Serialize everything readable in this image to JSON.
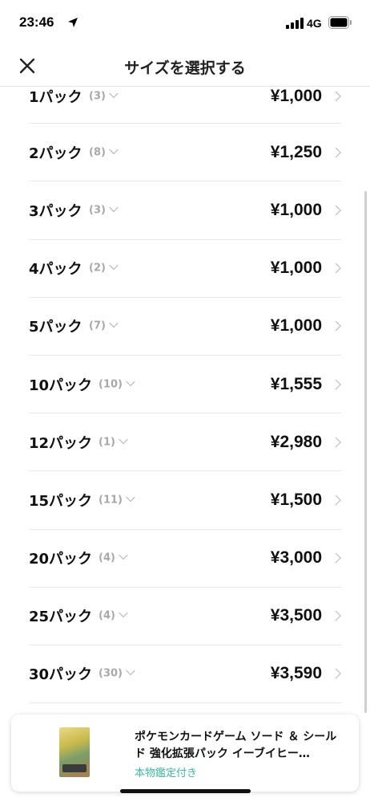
{
  "status_bar": {
    "time": "23:46",
    "network": "4G"
  },
  "header": {
    "title": "サイズを選択する"
  },
  "sizes": [
    {
      "label": "1パック",
      "count": "(3)",
      "price": "¥1,000"
    },
    {
      "label": "2パック",
      "count": "(8)",
      "price": "¥1,250"
    },
    {
      "label": "3パック",
      "count": "(3)",
      "price": "¥1,000"
    },
    {
      "label": "4パック",
      "count": "(2)",
      "price": "¥1,000"
    },
    {
      "label": "5パック",
      "count": "(7)",
      "price": "¥1,000"
    },
    {
      "label": "10パック",
      "count": "(10)",
      "price": "¥1,555"
    },
    {
      "label": "12パック",
      "count": "(1)",
      "price": "¥2,980"
    },
    {
      "label": "15パック",
      "count": "(11)",
      "price": "¥1,500"
    },
    {
      "label": "20パック",
      "count": "(4)",
      "price": "¥3,000"
    },
    {
      "label": "25パック",
      "count": "(4)",
      "price": "¥3,500"
    },
    {
      "label": "30パック",
      "count": "(30)",
      "price": "¥3,590"
    }
  ],
  "product": {
    "name": "ポケモンカードゲーム ソード ＆ シールド 強化拡張パック イーブイヒー…",
    "authentication": "本物鑑定付き"
  }
}
